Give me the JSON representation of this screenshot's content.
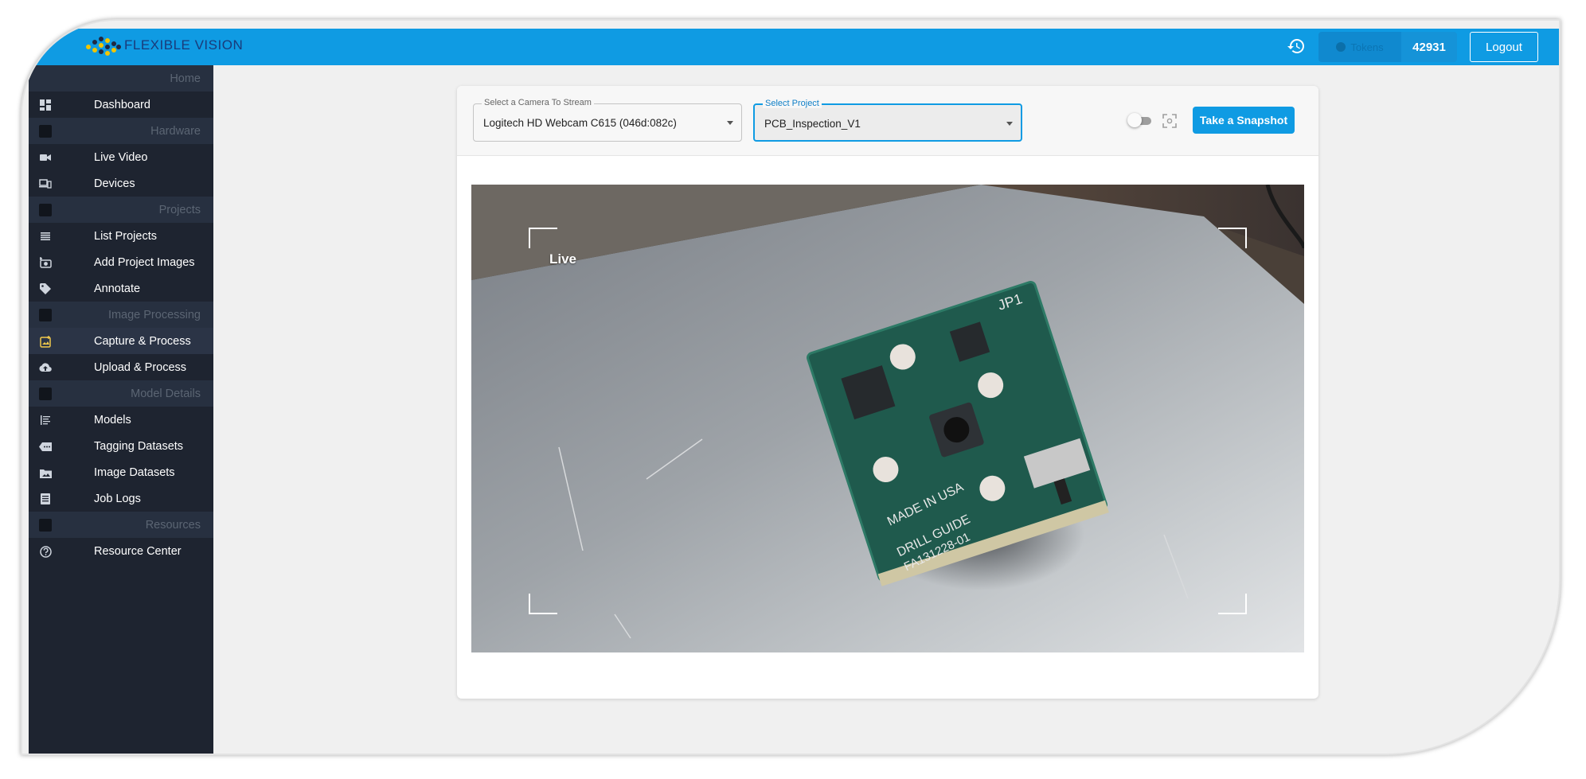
{
  "header": {
    "brand": "FLEXIBLE VISION",
    "tokens_label": "Tokens",
    "tokens_count": "42931",
    "logout_label": "Logout"
  },
  "sidebar": {
    "sections": [
      {
        "title": "Home",
        "items": [
          {
            "label": "Dashboard",
            "icon": "dashboard-icon"
          }
        ]
      },
      {
        "title": "Hardware",
        "items": [
          {
            "label": "Live Video",
            "icon": "video-camera-icon"
          },
          {
            "label": "Devices",
            "icon": "devices-icon"
          }
        ]
      },
      {
        "title": "Projects",
        "items": [
          {
            "label": "List Projects",
            "icon": "list-icon"
          },
          {
            "label": "Add Project Images",
            "icon": "add-photo-icon"
          },
          {
            "label": "Annotate",
            "icon": "tag-icon"
          }
        ]
      },
      {
        "title": "Image Processing",
        "items": [
          {
            "label": "Capture & Process",
            "icon": "capture-icon"
          },
          {
            "label": "Upload & Process",
            "icon": "cloud-upload-icon"
          }
        ]
      },
      {
        "title": "Model Details",
        "items": [
          {
            "label": "Models",
            "icon": "models-icon"
          },
          {
            "label": "Tagging Datasets",
            "icon": "label-icon"
          },
          {
            "label": "Image Datasets",
            "icon": "image-folder-icon"
          },
          {
            "label": "Job Logs",
            "icon": "document-icon"
          }
        ]
      },
      {
        "title": "Resources",
        "items": [
          {
            "label": "Resource Center",
            "icon": "help-icon"
          }
        ]
      }
    ],
    "active": "Capture & Process"
  },
  "controls": {
    "camera": {
      "label": "Select a Camera To Stream",
      "value": "Logitech HD Webcam C615 (046d:082c)"
    },
    "project": {
      "label": "Select Project",
      "value": "PCB_Inspection_V1"
    },
    "snapshot_label": "Take a Snapshot"
  },
  "video": {
    "status": "Live"
  },
  "colors": {
    "accent": "#0f9be3",
    "sidebar_bg": "#1e2430",
    "sidebar_section_bg": "#273040",
    "active_icon": "#f2c94c"
  }
}
